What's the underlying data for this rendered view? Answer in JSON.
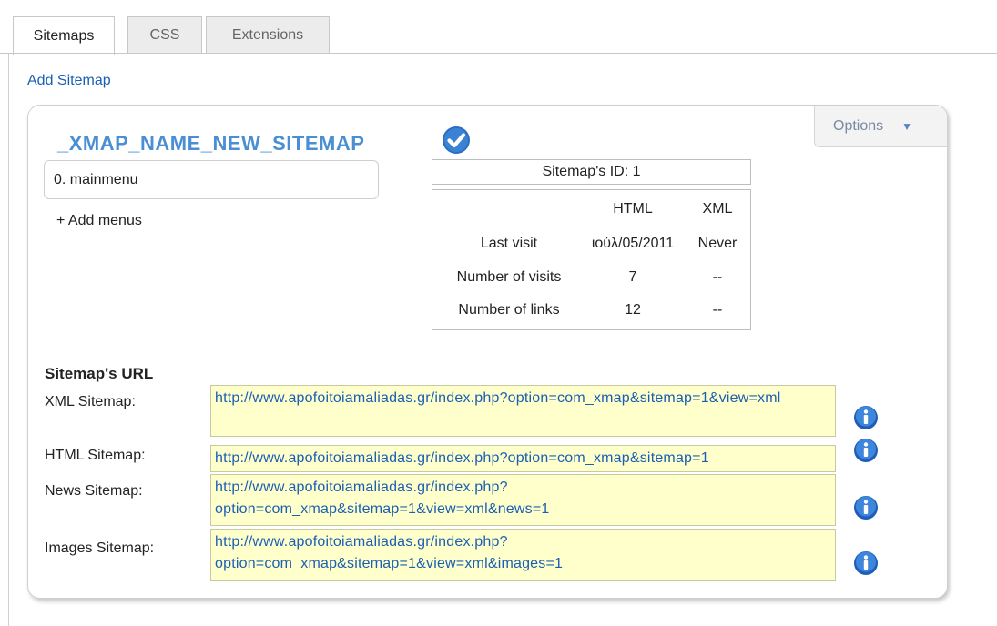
{
  "tabs": [
    "Sitemaps",
    "CSS",
    "Extensions"
  ],
  "add_sitemap_label": "Add Sitemap",
  "options_label": "Options",
  "sitemap": {
    "name": "_XMAP_NAME_NEW_SITEMAP",
    "menu_item": "0. mainmenu",
    "add_menus_label": "+  Add menus",
    "id_label": "Sitemap's ID: 1"
  },
  "stats": {
    "headers": [
      "HTML",
      "XML"
    ],
    "rows": [
      {
        "label": "Last visit",
        "html": "ιούλ/05/2011",
        "xml": "Never"
      },
      {
        "label": "Number of visits",
        "html": "7",
        "xml": "--"
      },
      {
        "label": "Number of links",
        "html": "12",
        "xml": "--"
      }
    ]
  },
  "urls": {
    "heading": "Sitemap's URL",
    "items": [
      {
        "label": "XML Sitemap:",
        "value": "http://www.apofoitoiamaliadas.gr/index.php?option=com_xmap&sitemap=1&view=xml"
      },
      {
        "label": "HTML Sitemap:",
        "value": "http://www.apofoitoiamaliadas.gr/index.php?option=com_xmap&sitemap=1"
      },
      {
        "label": "News Sitemap:",
        "value": "http://www.apofoitoiamaliadas.gr/index.php?option=com_xmap&sitemap=1&view=xml&news=1"
      },
      {
        "label": "Images Sitemap:",
        "value": "http://www.apofoitoiamaliadas.gr/index.php?option=com_xmap&sitemap=1&view=xml&images=1"
      }
    ]
  },
  "icons": {
    "check": "check-circle-icon",
    "info": "info-icon",
    "options_arrow": "triangle-down-icon"
  },
  "colors": {
    "accent": "#4a8fd3",
    "link": "#1a5fb4",
    "url_field_bg": "#ffffcc"
  }
}
